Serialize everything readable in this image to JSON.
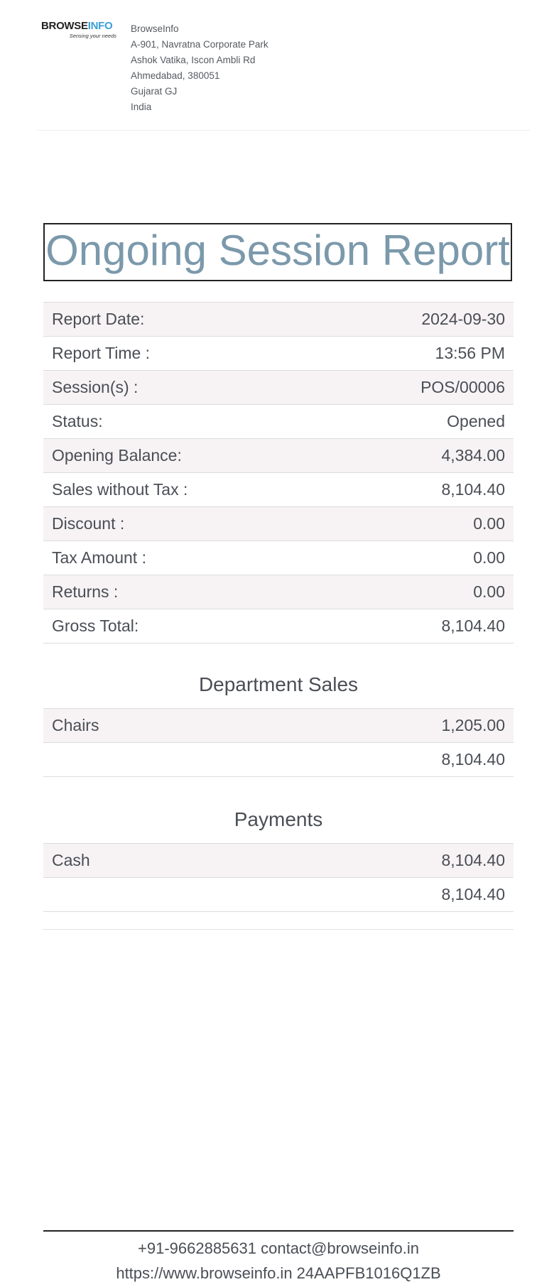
{
  "header": {
    "logo": {
      "text_main": "BROWSE",
      "text_accent": "INFO",
      "tagline": "Sensing your needs",
      "accent_color": "#3a9fd6"
    },
    "company": {
      "name": "BrowseInfo",
      "address_line1": "A-901, Navratna Corporate Park",
      "address_line2": "Ashok Vatika, Iscon Ambli Rd",
      "city_zip": "Ahmedabad, 380051",
      "state": "Gujarat GJ",
      "country": "India"
    }
  },
  "title": "Ongoing Session Report",
  "summary": [
    {
      "label": "Report Date:",
      "value": "2024-09-30"
    },
    {
      "label": "Report Time :",
      "value": "13:56 PM"
    },
    {
      "label": "Session(s) :",
      "value": "POS/00006"
    },
    {
      "label": "Status:",
      "value": "Opened"
    },
    {
      "label": "Opening Balance:",
      "value": "4,384.00"
    },
    {
      "label": "Sales without Tax :",
      "value": "8,104.40"
    },
    {
      "label": "Discount :",
      "value": "0.00"
    },
    {
      "label": "Tax Amount :",
      "value": "0.00"
    },
    {
      "label": "Returns :",
      "value": "0.00"
    },
    {
      "label": "Gross Total:",
      "value": "8,104.40"
    }
  ],
  "department_sales": {
    "heading": "Department Sales",
    "rows": [
      {
        "label": "Chairs",
        "value": "1,205.00"
      },
      {
        "label": "",
        "value": "8,104.40"
      }
    ]
  },
  "payments": {
    "heading": "Payments",
    "rows": [
      {
        "label": "Cash",
        "value": "8,104.40"
      },
      {
        "label": "",
        "value": "8,104.40"
      }
    ]
  },
  "footer": {
    "line1": "+91-9662885631 contact@browseinfo.in",
    "line2": "https://www.browseinfo.in 24AAPFB1016Q1ZB"
  },
  "colors": {
    "title": "#7b99ab",
    "row_stripe": "#f7f3f4",
    "text": "#4a4e55"
  }
}
